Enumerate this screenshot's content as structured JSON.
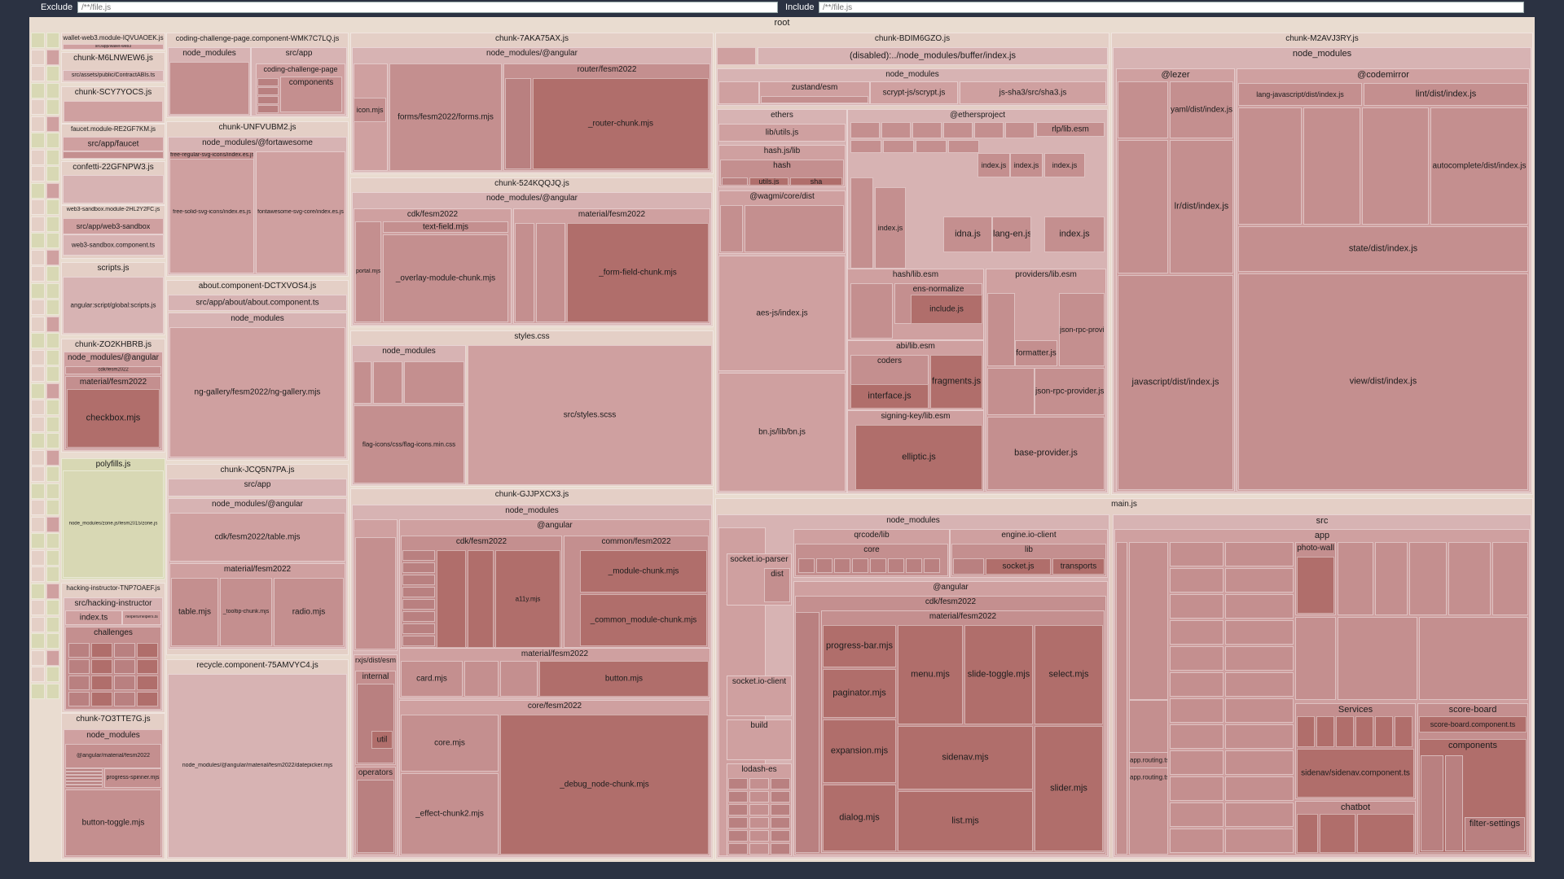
{
  "filter": {
    "exclude_label": "Exclude",
    "exclude_placeholder": "/**/file.js",
    "include_label": "Include",
    "include_placeholder": "/**/file.js"
  },
  "colors": {
    "background": "#2b3242",
    "root": "#e9dcd0",
    "header": "#e4cfc6",
    "light": "#d7b3b3",
    "medium": "#c48f8f",
    "dark": "#b06e6b",
    "olive": "#d8d8b4"
  },
  "treemap": {
    "root_label": "root",
    "chunks": [
      {
        "name": "wallet-web3.module-IQVUAOEK.js",
        "children": [
          "src/app/wallet-web3"
        ]
      },
      {
        "name": "chunk-M6LNWEW6.js",
        "children": [
          "src/assets/public/ContractABIs.ts"
        ]
      },
      {
        "name": "chunk-SCY7YOCS.js"
      },
      {
        "name": "faucet.module-RE2GF7KM.js",
        "children": [
          "src/app/faucet"
        ]
      },
      {
        "name": "confetti-22GFNPW3.js"
      },
      {
        "name": "web3-sandbox.module-2HL2Y2FC.js",
        "children": [
          "src/app/web3-sandbox",
          "web3-sandbox.component.ts"
        ]
      },
      {
        "name": "scripts.js",
        "children": [
          "angular:script/global:scripts.js"
        ]
      },
      {
        "name": "chunk-ZO2KHBRB.js",
        "children": [
          "node_modules/@angular",
          "cdk/fesm2022",
          "material/fesm2022",
          "checkbox.mjs"
        ]
      },
      {
        "name": "polyfills.js",
        "children": [
          "node_modules/zone.js/fesm2015/zone.js"
        ]
      },
      {
        "name": "hacking-instructor-TNP7OAEF.js",
        "children": [
          "src/hacking-instructor",
          "index.ts",
          "helpers/helpers.ts",
          "challenges"
        ]
      },
      {
        "name": "chunk-7O3TTE7G.js",
        "children": [
          "node_modules",
          "@angular/material/fesm2022",
          "progress-spinner.mjs",
          "button-toggle.mjs"
        ]
      },
      {
        "name": "coding-challenge-page.component-WMK7C7LQ.js",
        "children": [
          "node_modules",
          "src/app",
          "coding-challenge-page",
          "components"
        ]
      },
      {
        "name": "chunk-UNFVUBM2.js",
        "children": [
          "node_modules/@fortawesome",
          "free-regular-svg-icons/index.es.js",
          "free-solid-svg-icons/index.es.js",
          "fontawesome-svg-core/index.es.js"
        ]
      },
      {
        "name": "about.component-DCTXVOS4.js",
        "children": [
          "src/app/about/about.component.ts",
          "node_modules",
          "ng-gallery/fesm2022/ng-gallery.mjs"
        ]
      },
      {
        "name": "chunk-JCQ5N7PA.js",
        "children": [
          "src/app",
          "node_modules/@angular",
          "cdk/fesm2022/table.mjs",
          "material/fesm2022",
          "table.mjs",
          "_tooltip-chunk.mjs",
          "radio.mjs"
        ]
      },
      {
        "name": "recycle.component-75AMVYC4.js",
        "children": [
          "node_modules/@angular/material/fesm2022/datepicker.mjs"
        ]
      },
      {
        "name": "chunk-7AKA75AX.js",
        "children": [
          "node_modules/@angular",
          "forms/fesm2022/forms.mjs",
          "router/fesm2022",
          "_router-chunk.mjs",
          "icon.mjs"
        ]
      },
      {
        "name": "chunk-524KQQJQ.js",
        "children": [
          "node_modules/@angular",
          "cdk/fesm2022",
          "text-field.mjs",
          "_overlay-module-chunk.mjs",
          "material/fesm2022",
          "_form-field-chunk.mjs",
          "portal.mjs"
        ]
      },
      {
        "name": "styles.css",
        "children": [
          "node_modules",
          "flag-icons/css/flag-icons.min.css",
          "src/styles.scss"
        ]
      },
      {
        "name": "chunk-GJJPXCX3.js",
        "children": [
          "node_modules",
          "@angular",
          "cdk/fesm2022",
          "common/fesm2022",
          "_module-chunk.mjs",
          "_common_module-chunk.mjs",
          "material/fesm2022",
          "card.mjs",
          "button.mjs",
          "core/fesm2022",
          "core.mjs",
          "_effect-chunk2.mjs",
          "_debug_node-chunk.mjs",
          "rxjs/dist/esm",
          "internal",
          "util",
          "operators",
          "a11y.mjs"
        ]
      },
      {
        "name": "chunk-BDIM6GZO.js",
        "children": [
          "(disabled):../node_modules/buffer/index.js",
          "node_modules",
          "zustand/esm",
          "scrypt-js/scrypt.js",
          "js-sha3/src/sha3.js",
          "ethers",
          "lib/utils.js",
          "hash.js/lib",
          "hash",
          "utils.js",
          "sha",
          "@wagmi/core/dist",
          "aes-js/index.js",
          "bn.js/lib/bn.js",
          "@ethersproject",
          "rlp/lib.esm",
          "index.js",
          "idna.js",
          "lang-en.js",
          "hash/lib.esm",
          "ens-normalize",
          "include.js",
          "abi/lib.esm",
          "coders",
          "interface.js",
          "fragments.js",
          "signing-key/lib.esm",
          "elliptic.js",
          "providers/lib.esm",
          "formatter.js",
          "json-rpc-provider.js",
          "base-provider.js"
        ]
      },
      {
        "name": "chunk-M2AVJ3RY.js",
        "children": [
          "node_modules",
          "@lezer",
          "yaml/dist/index.js",
          "lr/dist/index.js",
          "javascript/dist/index.js",
          "@codemirror",
          "lang-javascript/dist/index.js",
          "lint/dist/index.js",
          "autocomplete/dist/index.js",
          "state/dist/index.js",
          "view/dist/index.js"
        ]
      },
      {
        "name": "main.js",
        "children": [
          "node_modules",
          "qrcode/lib",
          "core",
          "engine.io-client",
          "lib",
          "socket.js",
          "transports",
          "socket.io-parser",
          "dist",
          "socket.io-client",
          "build",
          "lodash-es",
          "@angular",
          "cdk/fesm2022",
          "material/fesm2022",
          "progress-bar.mjs",
          "paginator.mjs",
          "expansion.mjs",
          "dialog.mjs",
          "menu.mjs",
          "slide-toggle.mjs",
          "select.mjs",
          "sidenav.mjs",
          "list.mjs",
          "slider.mjs",
          "src",
          "app",
          "photo-wall",
          "app.routing.ts",
          "Services",
          "score-board",
          "score-board.component.ts",
          "components",
          "sidenav/sidenav.component.ts",
          "chatbot",
          "filter-settings"
        ]
      }
    ]
  }
}
